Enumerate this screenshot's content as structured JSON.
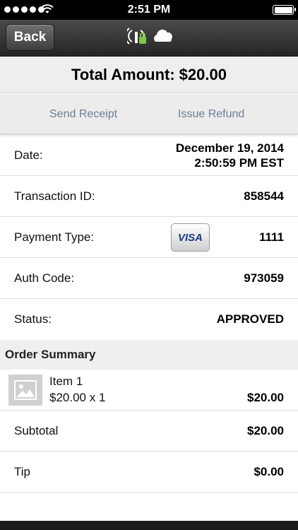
{
  "status_bar": {
    "time": "2:51 PM"
  },
  "nav": {
    "back_label": "Back"
  },
  "total": {
    "label": "Total Amount:",
    "amount": "$20.00"
  },
  "actions": {
    "send_receipt": "Send Receipt",
    "issue_refund": "Issue Refund"
  },
  "details": {
    "date_label": "Date:",
    "date_value_line1": "December 19, 2014",
    "date_value_line2": "2:50:59 PM EST",
    "transaction_label": "Transaction ID:",
    "transaction_value": "858544",
    "payment_label": "Payment Type:",
    "payment_card_brand": "VISA",
    "payment_value": "1111",
    "auth_label": "Auth Code:",
    "auth_value": "973059",
    "status_label": "Status:",
    "status_value": "APPROVED"
  },
  "order_summary": {
    "header": "Order Summary",
    "items": [
      {
        "name": "Item 1",
        "qty_line": "$20.00 x 1",
        "line_total": "$20.00"
      }
    ],
    "subtotal_label": "Subtotal",
    "subtotal_value": "$20.00",
    "tip_label": "Tip",
    "tip_value": "$0.00"
  },
  "colors": {
    "action_link": "#6c7e95",
    "nav_bg": "#333333",
    "section_bg": "#efefef"
  },
  "icons": [
    "wifi-icon",
    "battery-icon",
    "reader-connected-icon",
    "cloud-icon",
    "image-placeholder-icon"
  ]
}
